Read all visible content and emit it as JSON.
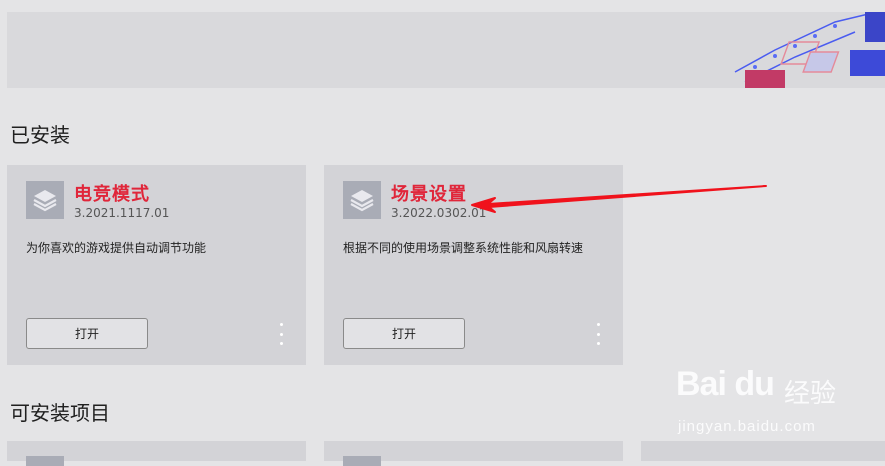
{
  "installed_section": {
    "title": "已安装"
  },
  "available_section": {
    "title": "可安装项目"
  },
  "cards": [
    {
      "name": "电竞模式",
      "version": "3.2021.1117.01",
      "description": "为你喜欢的游戏提供自动调节功能",
      "open_label": "打开"
    },
    {
      "name": "场景设置",
      "version": "3.2022.0302.01",
      "description": "根据不同的使用场景调整系统性能和风扇转速",
      "open_label": "打开"
    }
  ],
  "watermark": {
    "logo": "Bai du",
    "chinese": "经验",
    "url": "jingyan.baidu.com"
  },
  "colors": {
    "accent_red": "#e0263a",
    "background": "#e4e4e6",
    "card": "#d3d3d7"
  }
}
